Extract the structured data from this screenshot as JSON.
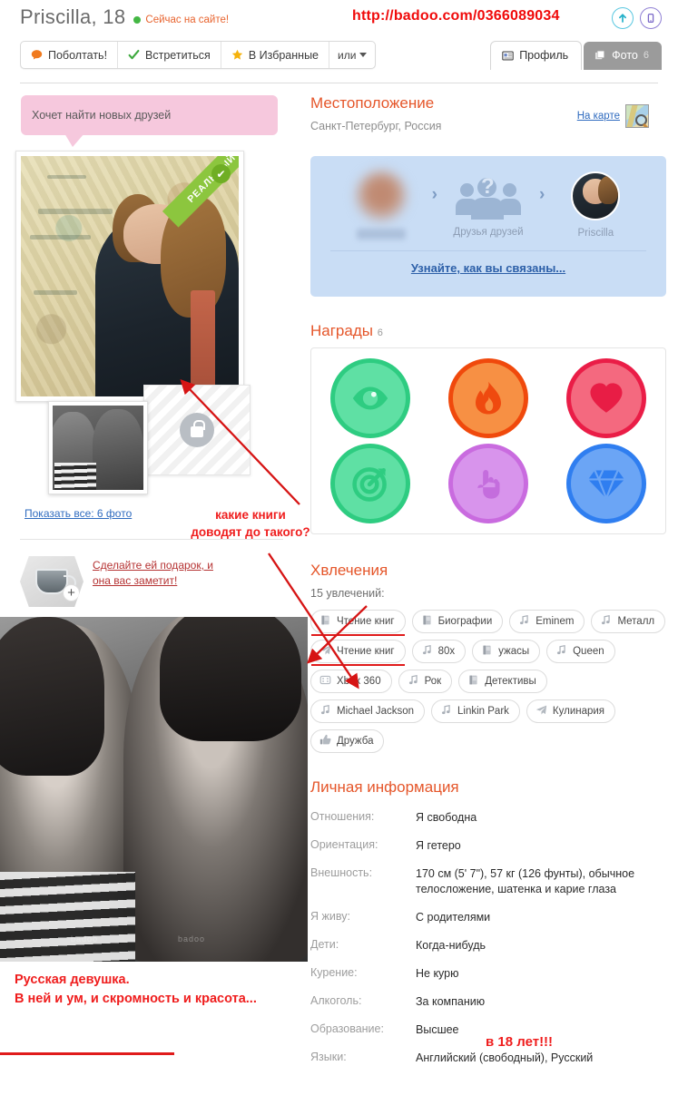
{
  "header": {
    "profile_name": "Priscilla, 18",
    "online_status": "Сейчас на сайте!",
    "url_annotation": "http://badoo.com/0366089034",
    "upload_icon": "upload-arrow-icon",
    "mobile_icon": "mobile-phone-icon",
    "actions": [
      {
        "label": "Поболтать!",
        "icon": "chat-bubble-icon"
      },
      {
        "label": "Встретиться",
        "icon": "check-mark-icon"
      },
      {
        "label": "В Избранные",
        "icon": "star-icon"
      }
    ],
    "more_label": "или",
    "tabs": [
      {
        "label": "Профиль",
        "icon": "profile-card-icon",
        "count": "",
        "active": true
      },
      {
        "label": "Фото",
        "icon": "photos-stack-icon",
        "count": "6",
        "active": false
      }
    ]
  },
  "left": {
    "status_bubble": "Хочет найти новых друзей",
    "verified_ribbon": "РЕАЛЬНЫЙ",
    "verified_check": "✔",
    "locked_photo_icon": "lock-icon",
    "show_all_photos": "Показать все: 6 фото",
    "gift_link": "Сделайте ей подарок, и она вас заметит!",
    "gift_icon": "gift-cup-icon",
    "gift_plus": "+",
    "bottom_caption_line1": "Русская девушка.",
    "bottom_caption_line2": "В ней и ум, и скромность и красота..."
  },
  "location": {
    "heading": "Местоположение",
    "value": "Санкт-Петербург, Россия",
    "map_link": "На карте",
    "map_icon": "map-magnifier-icon"
  },
  "connection": {
    "viewer_name": "",
    "middle_label": "Друзья друзей",
    "middle_icon": "friends-group-icon",
    "target_name": "Priscilla",
    "arrow": "›",
    "cta": "Узнайте, как вы связаны..."
  },
  "awards": {
    "heading": "Награды",
    "count": "6",
    "badges": [
      {
        "name": "eye-badge",
        "icon": "eye-icon",
        "ring": "#2ecc81",
        "fill": "#5fe0a4",
        "glyph": "#2ecc81"
      },
      {
        "name": "flame-badge",
        "icon": "flame-icon",
        "ring": "#f0490c",
        "fill": "#f79044",
        "glyph": "#ef4a0f"
      },
      {
        "name": "heart-badge",
        "icon": "heart-icon",
        "ring": "#ea1d47",
        "fill": "#f4697f",
        "glyph": "#e81d45"
      },
      {
        "name": "target-badge",
        "icon": "target-arrow-icon",
        "ring": "#2ecc81",
        "fill": "#5fe0a4",
        "glyph": "#2ecc81"
      },
      {
        "name": "hand-badge",
        "icon": "pointing-hand-icon",
        "ring": "#c96bdf",
        "fill": "#d894ec",
        "glyph": "#c46ddd"
      },
      {
        "name": "diamond-badge",
        "icon": "diamond-icon",
        "ring": "#2f7ef0",
        "fill": "#6ba5f5",
        "glyph": "#2f7ef0"
      }
    ]
  },
  "hobbies": {
    "heading": "Хвлечения",
    "count_label": "15 увлечений:",
    "tags": [
      {
        "label": "Чтение книг",
        "icon": "book-icon",
        "highlight": true
      },
      {
        "label": "Биографии",
        "icon": "book-icon",
        "highlight": false
      },
      {
        "label": "Eminem",
        "icon": "music-note-icon",
        "highlight": false
      },
      {
        "label": "Металл",
        "icon": "music-note-icon",
        "highlight": false
      },
      {
        "label": "Чтение книг",
        "icon": "paper-plane-icon",
        "highlight": true
      },
      {
        "label": "80х",
        "icon": "music-note-icon",
        "highlight": false
      },
      {
        "label": "ужасы",
        "icon": "book-icon",
        "highlight": false
      },
      {
        "label": "Queen",
        "icon": "music-note-icon",
        "highlight": false
      },
      {
        "label": "Xbox 360",
        "icon": "gamepad-icon",
        "highlight": false
      },
      {
        "label": "Рок",
        "icon": "music-note-icon",
        "highlight": false
      },
      {
        "label": "Детективы",
        "icon": "book-icon",
        "highlight": false
      },
      {
        "label": "Michael Jackson",
        "icon": "music-note-icon",
        "highlight": false
      },
      {
        "label": "Linkin Park",
        "icon": "music-note-icon",
        "highlight": false
      },
      {
        "label": "Кулинария",
        "icon": "paper-plane-icon",
        "highlight": false
      },
      {
        "label": "Дружба",
        "icon": "thumbs-up-icon",
        "highlight": false
      }
    ]
  },
  "personal": {
    "heading": "Личная информация",
    "rows": [
      {
        "key": "Отношения:",
        "value": "Я свободна"
      },
      {
        "key": "Ориентация:",
        "value": "Я гетеро"
      },
      {
        "key": "Внешность:",
        "value": "170 см (5' 7\"), 57 кг (126 фунты), обычное телосложение, шатенка и карие глаза"
      },
      {
        "key": "Я живу:",
        "value": "С родителями"
      },
      {
        "key": "Дети:",
        "value": "Когда-нибудь"
      },
      {
        "key": "Курение:",
        "value": "Не курю"
      },
      {
        "key": "Алкоголь:",
        "value": "За компанию"
      },
      {
        "key": "Образование:",
        "value": "Высшее"
      },
      {
        "key": "Языки:",
        "value": "Английский (свободный), Русский"
      }
    ]
  },
  "annotations": {
    "books_line1": "какие книги",
    "books_line2": "доводят до такого?",
    "education_note": "в 18 лет!!!",
    "accent_color": "#ef1d1d"
  }
}
